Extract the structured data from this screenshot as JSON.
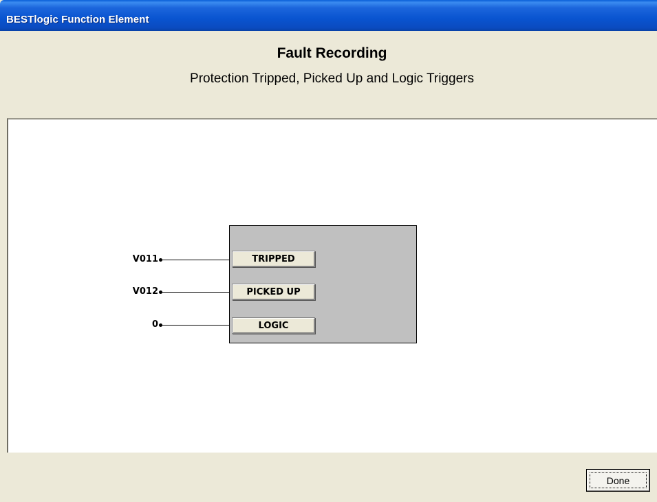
{
  "window": {
    "title": "BESTlogic Function Element"
  },
  "header": {
    "title": "Fault Recording",
    "subtitle": "Protection Tripped, Picked Up and Logic Triggers"
  },
  "block": {
    "inputs": [
      {
        "signal": "V011",
        "port": "TRIPPED"
      },
      {
        "signal": "V012",
        "port": "PICKED UP"
      },
      {
        "signal": "0",
        "port": "LOGIC"
      }
    ]
  },
  "footer": {
    "done_label": "Done"
  },
  "colors": {
    "titlebar": "#0a4bc0",
    "dialog_bg": "#ece9d8",
    "block_bg": "#c0c0c0"
  }
}
